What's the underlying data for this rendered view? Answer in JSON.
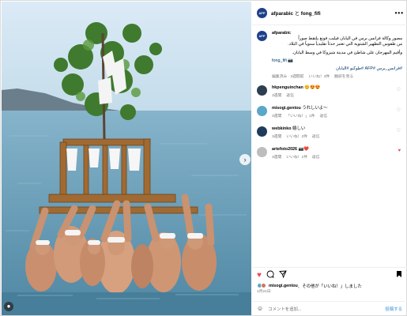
{
  "post_header": {
    "username": "afparabic",
    "collab_sep": "と",
    "collaborator": "fong_fifi",
    "more": "•••"
  },
  "caption": {
    "username": "afparabic",
    "line1": "مصور وكالة فرانس برس في اليابان فيليب فونغ يلتقط صوراً",
    "line2": "من طقوس التطهير الشتوية التي تعتبر حدثاً تقليدياً سنوياً في البلاد.",
    "line3": "وأقيم المهرجان على شاطئ في مدينة شيزوكا في وسط اليابان.",
    "credit": "fong_fifi 📷",
    "hashtags": "#فرانس_برس #AFP #طوكيو #اليابان",
    "meta_time": "編集済み · 3週間前",
    "meta_likes": "いいね！3件",
    "meta_translate": "翻訳を見る"
  },
  "comments": [
    {
      "username": "hkpenguinchan",
      "text": "😊😍😍",
      "meta_time": "3週間",
      "meta_likes": "",
      "meta_reply": "返信",
      "liked": false,
      "avatar_color": "#2c3e50"
    },
    {
      "username": "misogi.gentou",
      "text": "うれしいよ〜",
      "meta_time": "3週間",
      "meta_likes": "「いいね！」1件",
      "meta_reply": "返信",
      "liked": false,
      "avatar_color": "#5aa7c7"
    },
    {
      "username": "webkinko",
      "text": "嬉しい",
      "meta_time": "3週間",
      "meta_likes": "いいね！2件",
      "meta_reply": "返信",
      "liked": false,
      "avatar_color": "#1f3b5c"
    },
    {
      "username": "artefoto2026",
      "text": "📷❤️",
      "meta_time": "3週間",
      "meta_likes": "いいね！1件",
      "meta_reply": "返信",
      "liked": true,
      "avatar_color": "#8a8a8a"
    }
  ],
  "footer": {
    "likes_user": "misogi.gentou",
    "likes_suffix": "、その他が「いいね！」しました",
    "date": "1月21日",
    "comment_placeholder": "コメントを追加...",
    "post_label": "投稿する"
  },
  "icons": {
    "like": "heart-filled-red",
    "comment": "speech-bubble",
    "share": "paper-plane",
    "save": "bookmark-filled",
    "emoji": "smiley-face"
  },
  "colors": {
    "like_red": "#ed4956",
    "link_blue": "#00376b",
    "post_blue": "#7fb7e8",
    "muted": "#737373"
  }
}
